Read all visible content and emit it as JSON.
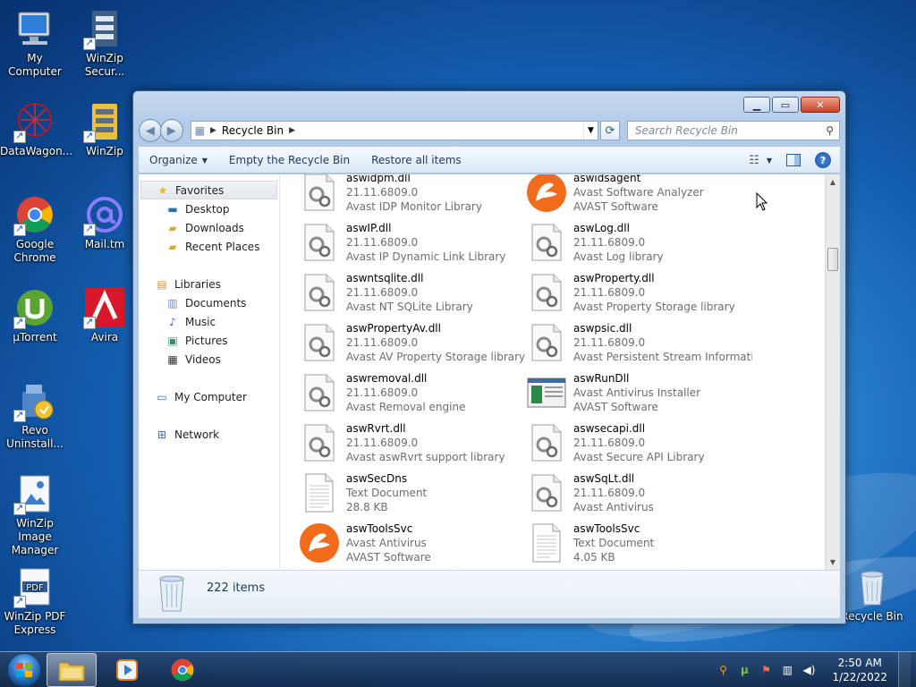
{
  "desktop": {
    "icons": [
      {
        "label": "My Computer"
      },
      {
        "label": "WinZip Secur..."
      },
      {
        "label": "DataWagon..."
      },
      {
        "label": "WinZip"
      },
      {
        "label": "Google Chrome"
      },
      {
        "label": "Mail.tm"
      },
      {
        "label": "µTorrent"
      },
      {
        "label": "Avira"
      },
      {
        "label": "Revo Uninstall..."
      },
      {
        "label": "WinZip Image Manager"
      },
      {
        "label": "WinZip PDF Express"
      },
      {
        "label": "Recycle Bin"
      }
    ]
  },
  "window": {
    "address": {
      "crumb": "Recycle Bin"
    },
    "search": {
      "placeholder": "Search Recycle Bin"
    },
    "toolbar": {
      "organize": "Organize",
      "empty": "Empty the Recycle Bin",
      "restore": "Restore all items"
    },
    "nav": {
      "favorites": "Favorites",
      "favorites_items": [
        "Desktop",
        "Downloads",
        "Recent Places"
      ],
      "libraries": "Libraries",
      "libraries_items": [
        "Documents",
        "Music",
        "Pictures",
        "Videos"
      ],
      "computer": "My Computer",
      "network": "Network"
    },
    "files": [
      {
        "name": "aswidpm.dll",
        "l2": "21.11.6809.0",
        "l3": "Avast IDP Monitor Library",
        "icon": "dll"
      },
      {
        "name": "aswidsagent",
        "l2": "Avast Software Analyzer",
        "l3": "AVAST Software",
        "icon": "avast"
      },
      {
        "name": "aswIP.dll",
        "l2": "21.11.6809.0",
        "l3": "Avast IP Dynamic Link Library",
        "icon": "dll"
      },
      {
        "name": "aswLog.dll",
        "l2": "21.11.6809.0",
        "l3": "Avast Log library",
        "icon": "dll"
      },
      {
        "name": "aswntsqlite.dll",
        "l2": "21.11.6809.0",
        "l3": "Avast NT SQLite Library",
        "icon": "dll"
      },
      {
        "name": "aswProperty.dll",
        "l2": "21.11.6809.0",
        "l3": "Avast Property Storage library",
        "icon": "dll"
      },
      {
        "name": "aswPropertyAv.dll",
        "l2": "21.11.6809.0",
        "l3": "Avast AV Property Storage library",
        "icon": "dll"
      },
      {
        "name": "aswpsic.dll",
        "l2": "21.11.6809.0",
        "l3": "Avast Persistent Stream Informati...",
        "icon": "dll"
      },
      {
        "name": "aswremoval.dll",
        "l2": "21.11.6809.0",
        "l3": "Avast Removal engine",
        "icon": "dll"
      },
      {
        "name": "aswRunDll",
        "l2": "Avast Antivirus Installer",
        "l3": "AVAST Software",
        "icon": "installer"
      },
      {
        "name": "aswRvrt.dll",
        "l2": "21.11.6809.0",
        "l3": "Avast aswRvrt support library",
        "icon": "dll"
      },
      {
        "name": "aswsecapi.dll",
        "l2": "21.11.6809.0",
        "l3": "Avast Secure API Library",
        "icon": "dll"
      },
      {
        "name": "aswSecDns",
        "l2": "Text Document",
        "l3": "28.8 KB",
        "icon": "text"
      },
      {
        "name": "aswSqLt.dll",
        "l2": "21.11.6809.0",
        "l3": "Avast Antivirus",
        "icon": "dll"
      },
      {
        "name": "aswToolsSvc",
        "l2": "Avast Antivirus",
        "l3": "AVAST Software",
        "icon": "avast"
      },
      {
        "name": "aswToolsSvc",
        "l2": "Text Document",
        "l3": "4.05 KB",
        "icon": "text"
      }
    ],
    "status": {
      "count": "222 items"
    }
  },
  "taskbar": {
    "clock": {
      "time": "2:50 AM",
      "date": "1/22/2022"
    }
  },
  "colors": {
    "avast_orange": "#f26b1d",
    "accent_blue": "#1e395b"
  }
}
